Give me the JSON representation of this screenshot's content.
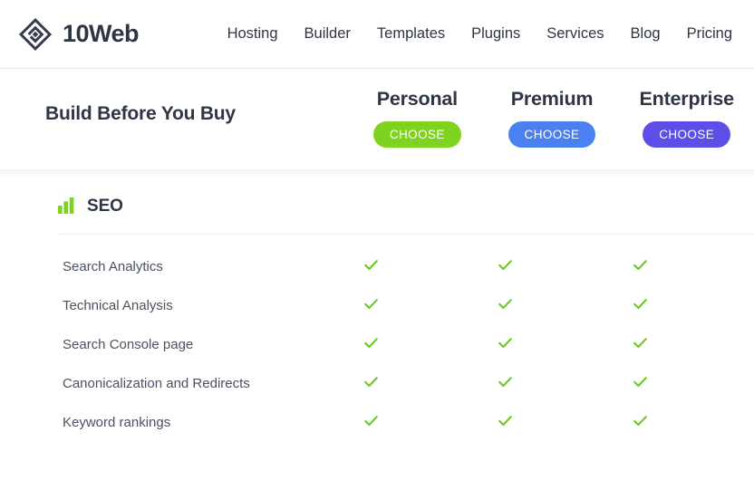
{
  "brand": {
    "name": "10Web",
    "logo_icon": "diamond-spiral-logo"
  },
  "nav": {
    "items": [
      {
        "label": "Hosting"
      },
      {
        "label": "Builder"
      },
      {
        "label": "Templates"
      },
      {
        "label": "Plugins"
      },
      {
        "label": "Services"
      },
      {
        "label": "Blog"
      },
      {
        "label": "Pricing"
      }
    ]
  },
  "plan_header": {
    "title": "Build Before You Buy",
    "plans": [
      {
        "name": "Personal",
        "cta": "CHOOSE",
        "color": "#7ed321"
      },
      {
        "name": "Premium",
        "cta": "CHOOSE",
        "color": "#4a80f0"
      },
      {
        "name": "Enterprise",
        "cta": "CHOOSE",
        "color": "#5d4ee8"
      }
    ]
  },
  "feature_section": {
    "title": "SEO",
    "icon": "bar-chart-icon",
    "icon_color": "#7ed321",
    "check_color": "#6dc720",
    "rows": [
      {
        "name": "Search Analytics",
        "personal": true,
        "premium": true,
        "enterprise": true
      },
      {
        "name": "Technical Analysis",
        "personal": true,
        "premium": true,
        "enterprise": true
      },
      {
        "name": "Search Console page",
        "personal": true,
        "premium": true,
        "enterprise": true
      },
      {
        "name": "Canonicalization and Redirects",
        "personal": true,
        "premium": true,
        "enterprise": true
      },
      {
        "name": "Keyword rankings",
        "personal": true,
        "premium": true,
        "enterprise": true
      }
    ]
  }
}
